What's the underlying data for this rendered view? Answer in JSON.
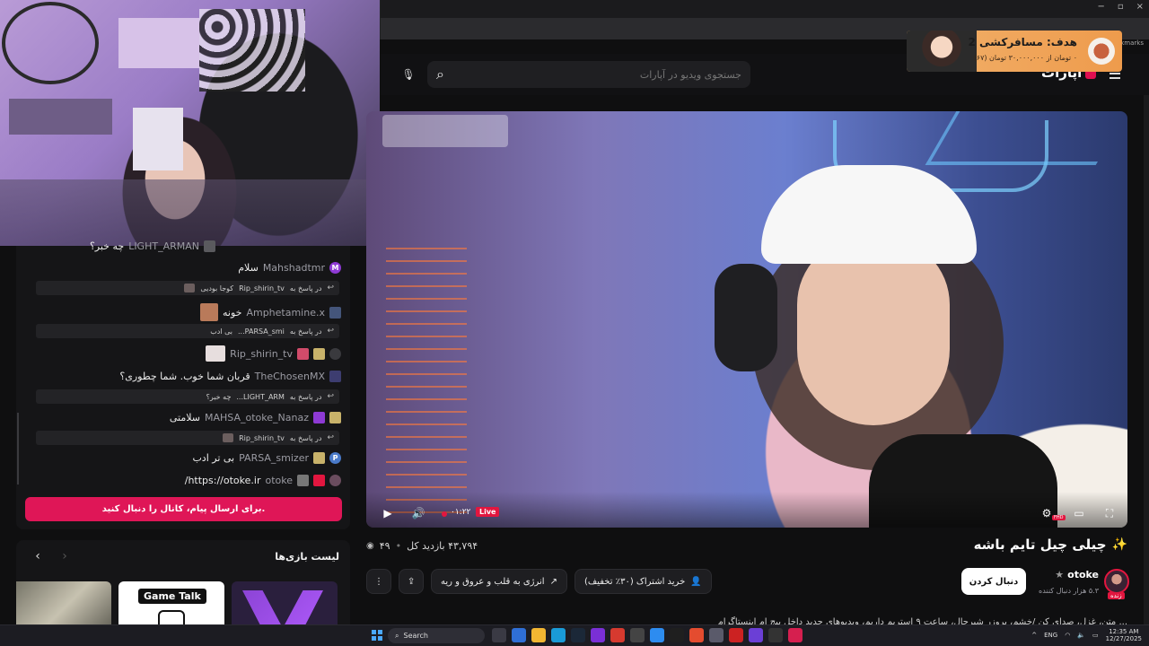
{
  "browser": {
    "bookmarks_label": "Bookmarks",
    "window_controls": [
      "−",
      "▫",
      "×"
    ]
  },
  "site": {
    "logo_text": "آپارات",
    "search_placeholder": "جستجوی ویدیو در آپارات"
  },
  "goal_banner": {
    "title": "هدف: مسافرکشی 2",
    "subtitle": "۰ تومان از ۳۰,۰۰۰,۰۰۰ تومان (۶۷)"
  },
  "chat": {
    "messages": [
      {
        "user": "LIGHT_ARMAN",
        "text": "چه خبر؟"
      },
      {
        "user": "Mahshadtmr",
        "text": "سلام",
        "badge": "M"
      },
      {
        "reply_prefix": "در پاسخ به",
        "reply_user": "Rip_shirin_tv",
        "reply_text": "کوجا بودیی"
      },
      {
        "user": "Amphetamine.x",
        "text": "خونه"
      },
      {
        "reply_prefix": "در پاسخ به",
        "reply_user": "PARSA_smi...",
        "reply_text": "بی ادب"
      },
      {
        "user": "Rip_shirin_tv",
        "text": ""
      },
      {
        "user": "TheChosenMX",
        "text": "قربان شما خوب. شما چطوری؟"
      },
      {
        "reply_prefix": "در پاسخ به",
        "reply_user": "LIGHT_ARM...",
        "reply_text": "چه خبر؟"
      },
      {
        "user": "MAHSA_otoke_Nanaz",
        "text": "سلامتی"
      },
      {
        "reply_prefix": "در پاسخ به",
        "reply_user": "Rip_shirin_tv",
        "reply_text": ""
      },
      {
        "user": "PARSA_smizer",
        "text": "بی تر ادب",
        "badge": "P"
      },
      {
        "user": "otoke",
        "text": "https://otoke.ir/"
      }
    ],
    "send_button": "برای ارسال پیام، کانال را دنبال کنید."
  },
  "games": {
    "title": "لیست بازی‌ها",
    "prev": "‹",
    "next": "›",
    "card2_label": "Game Talk"
  },
  "player": {
    "time": "۰۱:۲۲",
    "live_label": "Live",
    "hd_label": "FHD"
  },
  "video": {
    "title": "چیلی چیل تایم باشه",
    "sparkle": "✨",
    "views": "۴۳,۷۹۴ بازدید کل",
    "watching": "۴۹",
    "buy_sub": "خرید اشتراک (۳۰٪ تخفیف)",
    "energy": "انرژی به قلب و عروق و ریه",
    "follow": "دنبال کردن",
    "channel": "otoke",
    "followers": "۵.۳ هزار دنبال کننده",
    "live_chip": "زنده",
    "description": "... متن، غزل، صدای کن /خشم، بروزر شیرجال، ساعت ۹ استریم داریم، ویدیوهای جدید داخل پیج ام اینستاگرام"
  },
  "taskbar": {
    "search_label": "Search",
    "lang": "ENG",
    "time": "12:35 AM",
    "date": "12/27/2025"
  },
  "colors": {
    "accent": "#df1657",
    "live": "#e2163f",
    "link": "#5da2ff"
  }
}
